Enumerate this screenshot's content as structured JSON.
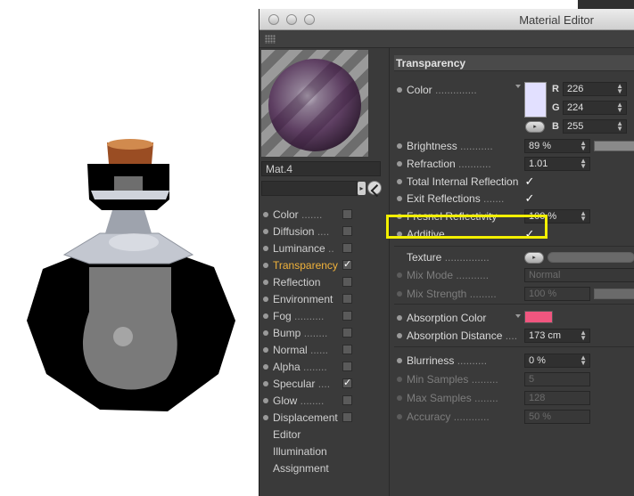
{
  "window": {
    "title": "Material Editor"
  },
  "material": {
    "name": "Mat.4"
  },
  "channels": [
    {
      "label": "Color",
      "leader": " .......",
      "checked": false,
      "active": false,
      "has_checkbox": true,
      "has_dot": true
    },
    {
      "label": "Diffusion",
      "leader": " ....",
      "checked": false,
      "active": false,
      "has_checkbox": true,
      "has_dot": true
    },
    {
      "label": "Luminance",
      "leader": " ..",
      "checked": false,
      "active": false,
      "has_checkbox": true,
      "has_dot": true
    },
    {
      "label": "Transparency",
      "leader": "",
      "checked": true,
      "active": true,
      "has_checkbox": true,
      "has_dot": true
    },
    {
      "label": "Reflection",
      "leader": "",
      "checked": false,
      "active": false,
      "has_checkbox": true,
      "has_dot": true
    },
    {
      "label": "Environment",
      "leader": "",
      "checked": false,
      "active": false,
      "has_checkbox": true,
      "has_dot": true
    },
    {
      "label": "Fog",
      "leader": " ..........",
      "checked": false,
      "active": false,
      "has_checkbox": true,
      "has_dot": true
    },
    {
      "label": "Bump",
      "leader": " ........",
      "checked": false,
      "active": false,
      "has_checkbox": true,
      "has_dot": true
    },
    {
      "label": "Normal",
      "leader": " ......",
      "checked": false,
      "active": false,
      "has_checkbox": true,
      "has_dot": true
    },
    {
      "label": "Alpha",
      "leader": " ........",
      "checked": false,
      "active": false,
      "has_checkbox": true,
      "has_dot": true
    },
    {
      "label": "Specular",
      "leader": " ....",
      "checked": true,
      "active": false,
      "has_checkbox": true,
      "has_dot": true
    },
    {
      "label": "Glow",
      "leader": " ........",
      "checked": false,
      "active": false,
      "has_checkbox": true,
      "has_dot": true
    },
    {
      "label": "Displacement",
      "leader": "",
      "checked": false,
      "active": false,
      "has_checkbox": true,
      "has_dot": true
    },
    {
      "label": "Editor",
      "leader": "",
      "checked": false,
      "active": false,
      "has_checkbox": false,
      "has_dot": false
    },
    {
      "label": "Illumination",
      "leader": "",
      "checked": false,
      "active": false,
      "has_checkbox": false,
      "has_dot": false
    },
    {
      "label": "Assignment",
      "leader": "",
      "checked": false,
      "active": false,
      "has_checkbox": false,
      "has_dot": false
    }
  ],
  "transparency": {
    "section_title": "Transparency",
    "color": {
      "label": "Color",
      "leader": " ..............",
      "r_label": "R",
      "g_label": "G",
      "b_label": "B",
      "r": "226",
      "g": "224",
      "b": "255",
      "swatch": "#e2e0ff"
    },
    "brightness": {
      "label": "Brightness",
      "leader": " ...........",
      "value": "89 %",
      "fraction": 0.89
    },
    "refraction": {
      "label": "Refraction",
      "leader": " ...........",
      "value": "1.01"
    },
    "total_internal_reflection": {
      "label": "Total Internal Reflection",
      "checked": "✓"
    },
    "exit_reflections": {
      "label": "Exit Reflections",
      "leader": " .......",
      "checked": "✓"
    },
    "fresnel_reflectivity": {
      "label": "Fresnel Reflectivity",
      "value": "100 %"
    },
    "additive": {
      "label": "Additive",
      "leader": " ............",
      "checked": "✓"
    },
    "texture": {
      "label": "Texture",
      "leader": " ...............",
      "button": "▸"
    },
    "mix_mode": {
      "label": "Mix Mode",
      "leader": " ...........",
      "value": "Normal"
    },
    "mix_strength": {
      "label": "Mix Strength",
      "leader": " .........",
      "value": "100 %"
    },
    "absorption_color": {
      "label": "Absorption Color",
      "swatch": "#f0567f"
    },
    "absorption_distance": {
      "label": "Absorption Distance",
      "leader": " ....",
      "value": "173 cm"
    },
    "blurriness": {
      "label": "Blurriness",
      "leader": " ..........",
      "value": "0 %"
    },
    "min_samples": {
      "label": "Min Samples",
      "leader": " .........",
      "value": "5"
    },
    "max_samples": {
      "label": "Max Samples",
      "leader": " ........",
      "value": "128"
    },
    "accuracy": {
      "label": "Accuracy",
      "leader": " ............",
      "value": "50 %"
    }
  },
  "colors": {
    "accent": "#f0b23a",
    "highlight": "#f3f000",
    "panel": "#3a3a3a"
  }
}
